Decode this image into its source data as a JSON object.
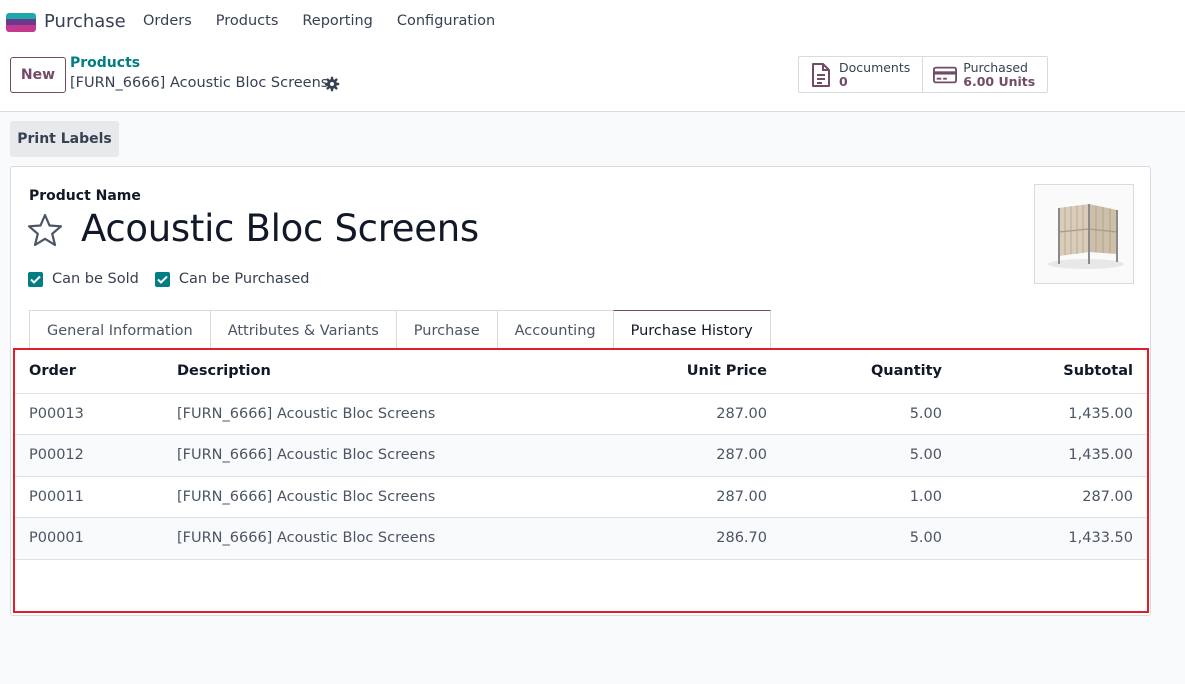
{
  "navbar": {
    "app_name": "Purchase",
    "menu": [
      "Orders",
      "Products",
      "Reporting",
      "Configuration"
    ]
  },
  "control": {
    "new_label": "New",
    "breadcrumb_parent": "Products",
    "breadcrumb_current": "[FURN_6666] Acoustic Bloc Screens",
    "smart_buttons": {
      "documents": {
        "label": "Documents",
        "value": "0"
      },
      "purchased": {
        "label": "Purchased",
        "value": "6.00 Units"
      }
    },
    "print_labels": "Print Labels"
  },
  "form": {
    "product_name_label": "Product Name",
    "product_name": "Acoustic Bloc Screens",
    "can_be_sold": "Can be Sold",
    "can_be_purchased": "Can be Purchased",
    "tabs": [
      "General Information",
      "Attributes & Variants",
      "Purchase",
      "Accounting",
      "Purchase History"
    ],
    "active_tab": "Purchase History"
  },
  "history": {
    "columns": [
      "Order",
      "Description",
      "Unit Price",
      "Quantity",
      "Subtotal"
    ],
    "rows": [
      [
        "P00013",
        "[FURN_6666] Acoustic Bloc Screens",
        "287.00",
        "5.00",
        "1,435.00"
      ],
      [
        "P00012",
        "[FURN_6666] Acoustic Bloc Screens",
        "287.00",
        "5.00",
        "1,435.00"
      ],
      [
        "P00011",
        "[FURN_6666] Acoustic Bloc Screens",
        "287.00",
        "1.00",
        "287.00"
      ],
      [
        "P00001",
        "[FURN_6666] Acoustic Bloc Screens",
        "286.70",
        "5.00",
        "1,433.50"
      ]
    ]
  },
  "colors": {
    "brand": "#714b67",
    "accent": "#017e84",
    "highlight": "#e11d2a"
  }
}
